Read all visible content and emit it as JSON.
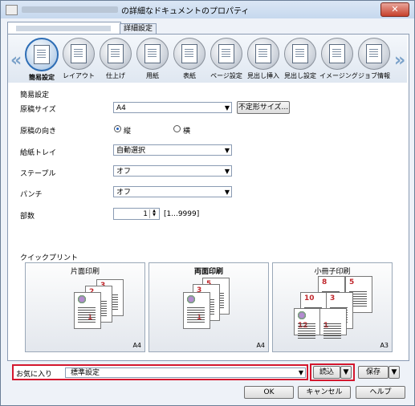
{
  "window": {
    "title": "の詳細なドキュメントのプロパティ",
    "close_label": "✕"
  },
  "tabs": {
    "detail_label": "詳細設定"
  },
  "iconbar": {
    "items": [
      {
        "label": "簡易設定",
        "icon": "quick-settings-icon",
        "active": true
      },
      {
        "label": "レイアウト",
        "icon": "layout-icon"
      },
      {
        "label": "仕上げ",
        "icon": "finishing-icon"
      },
      {
        "label": "用紙",
        "icon": "paper-icon"
      },
      {
        "label": "表紙",
        "icon": "cover-icon"
      },
      {
        "label": "ページ設定",
        "icon": "page-setting-icon"
      },
      {
        "label": "見出し挿入",
        "icon": "tab-insert-icon"
      },
      {
        "label": "見出し設定",
        "icon": "tab-setting-icon"
      },
      {
        "label": "イメージング",
        "icon": "imaging-icon"
      },
      {
        "label": "ジョブ情報",
        "icon": "job-info-icon"
      }
    ],
    "prev": "«",
    "next": "»"
  },
  "section": {
    "title": "簡易設定"
  },
  "form": {
    "original_size": {
      "label": "原稿サイズ",
      "value": "A4",
      "custom_button": "不定形サイズ..."
    },
    "orientation": {
      "label": "原稿の向き",
      "portrait": "縦",
      "landscape": "横",
      "selected": "portrait"
    },
    "paper_tray": {
      "label": "給紙トレイ",
      "value": "自動選択"
    },
    "staple": {
      "label": "ステープル",
      "value": "オフ"
    },
    "punch": {
      "label": "パンチ",
      "value": "オフ"
    },
    "copies": {
      "label": "部数",
      "value": "1",
      "range": "[1...9999]"
    }
  },
  "quick_print": {
    "title": "クイックプリント",
    "presets": [
      {
        "label": "片面印刷",
        "size": "A4"
      },
      {
        "label": "両面印刷",
        "size": "A4"
      },
      {
        "label": "小冊子印刷",
        "size": "A3"
      }
    ]
  },
  "favorites": {
    "label": "お気に入り",
    "value": "標準設定",
    "load_button": "読込",
    "save_button": "保存"
  },
  "footer": {
    "ok": "OK",
    "cancel": "キャンセル",
    "help": "ヘルプ"
  },
  "colors": {
    "accent": "#2d6db5",
    "highlight_box": "#d4172e",
    "page_number": "#c0282d"
  }
}
